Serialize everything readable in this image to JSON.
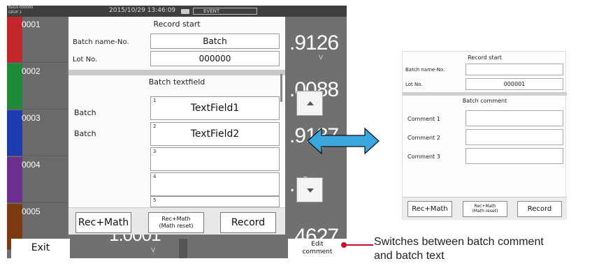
{
  "status_bar": {
    "batch_id": "Batch-000000",
    "group": "GRUP 1",
    "datetime": "2015/10/29 13:46:09",
    "event_label": "EVENT"
  },
  "channels": [
    {
      "label": "0001",
      "color": "#c0262a"
    },
    {
      "label": "0002",
      "color": "#1f8a3a"
    },
    {
      "label": "0003",
      "color": "#1f3bb0"
    },
    {
      "label": "0004",
      "color": "#6d2f8e"
    },
    {
      "label": "0005",
      "color": "#7a3b12"
    }
  ],
  "readings": [
    {
      "value": ".9126",
      "unit": "V"
    },
    {
      "value": ".0088",
      "unit": ""
    },
    {
      "value": ".9187",
      "unit": "V"
    },
    {
      "value": ". 9",
      "unit": ""
    },
    {
      "value": "1.0001",
      "unit": "V"
    },
    {
      "value": ".4627",
      "unit": ""
    }
  ],
  "dialog": {
    "title": "Record start",
    "batch_name_label": "Batch name-No.",
    "batch_name_value": "Batch",
    "lot_no_label": "Lot No.",
    "lot_no_value": "000000",
    "section_title": "Batch textfield",
    "text_fields": [
      {
        "index": "1",
        "label": "Batch",
        "value": "TextField1"
      },
      {
        "index": "2",
        "label": "Batch",
        "value": "TextField2"
      },
      {
        "index": "3",
        "label": "",
        "value": ""
      },
      {
        "index": "4",
        "label": "",
        "value": ""
      },
      {
        "index": "5",
        "label": "",
        "value": ""
      }
    ],
    "buttons": {
      "rec_math": "Rec+Math",
      "rec_math_reset_line1": "Rec+Math",
      "rec_math_reset_line2": "(Math reset)",
      "record": "Record"
    }
  },
  "bottom": {
    "exit": "Exit",
    "edit_comment_line1": "Edit",
    "edit_comment_line2": "comment"
  },
  "small_screen": {
    "title": "Record start",
    "batch_name_label": "Batch name-No.",
    "batch_name_value": "",
    "lot_no_label": "Lot No.",
    "lot_no_value": "000001",
    "section_title": "Batch comment",
    "comments": [
      {
        "label": "Comment 1",
        "value": ""
      },
      {
        "label": "Comment 2",
        "value": ""
      },
      {
        "label": "Comment 3",
        "value": ""
      }
    ],
    "buttons": {
      "rec_math": "Rec+Math",
      "rec_math_reset_line1": "Rec+Math",
      "rec_math_reset_line2": "(Math reset)",
      "record": "Record"
    }
  },
  "annotation": {
    "line1": "Switches between batch comment",
    "line2": "and batch text"
  },
  "colors": {
    "arrow": "#3aa6dd",
    "callout": "#c8102e"
  }
}
